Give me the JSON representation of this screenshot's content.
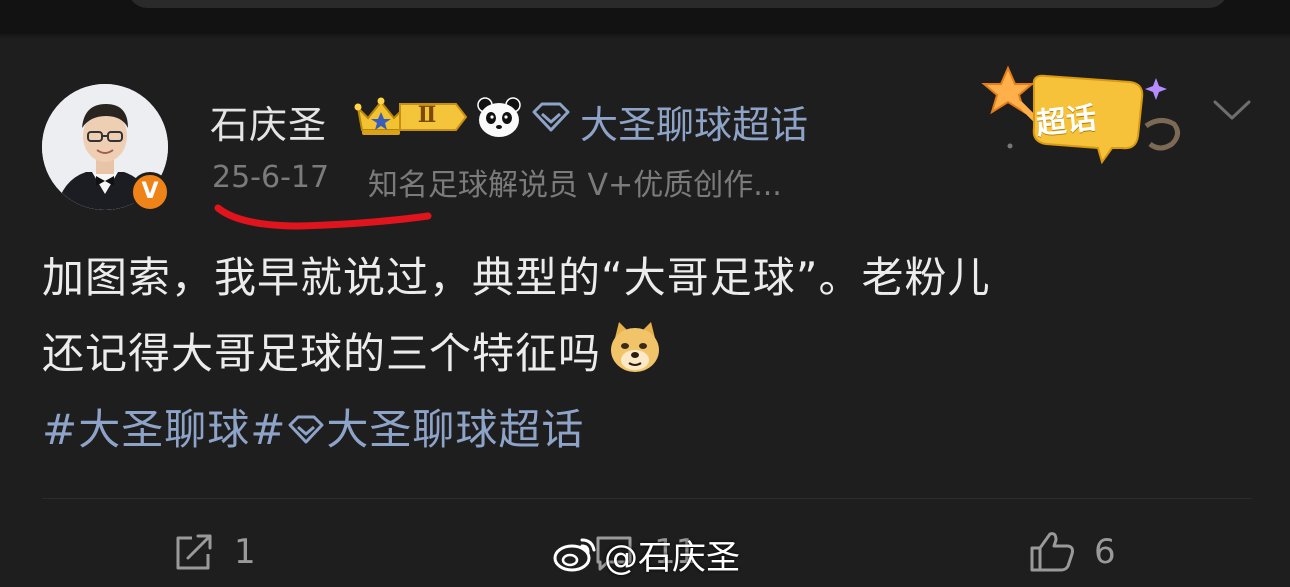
{
  "user": {
    "name": "石庆圣",
    "level": "Ⅱ",
    "verified_badge": "V",
    "topic_link": "大圣聊球超话"
  },
  "meta": {
    "date": "25-6-17",
    "description": "知名足球解说员 V+优质创作..."
  },
  "supertopic_badge": {
    "label": "超话"
  },
  "post": {
    "line1": "加图索，我早就说过，典型的“大哥足球”。老粉儿",
    "line2": "还记得大哥足球的三个特征吗",
    "hashtag1": "#大圣聊球#",
    "hashtag2": "大圣聊球超话"
  },
  "actions": {
    "share_count": "1",
    "comment_count": "11",
    "like_count": "6"
  },
  "watermark": {
    "text": "@石庆圣"
  },
  "colors": {
    "background": "#1e1e1e",
    "link": "#8ea3c8",
    "accent_orange": "#f08318",
    "annotation_red": "#e0141c"
  },
  "icons": [
    "crown-icon",
    "panda-icon",
    "diamond-icon",
    "chevron-down-icon",
    "doge-emoji-icon",
    "share-icon",
    "comment-icon",
    "like-icon",
    "weibo-logo-icon"
  ]
}
